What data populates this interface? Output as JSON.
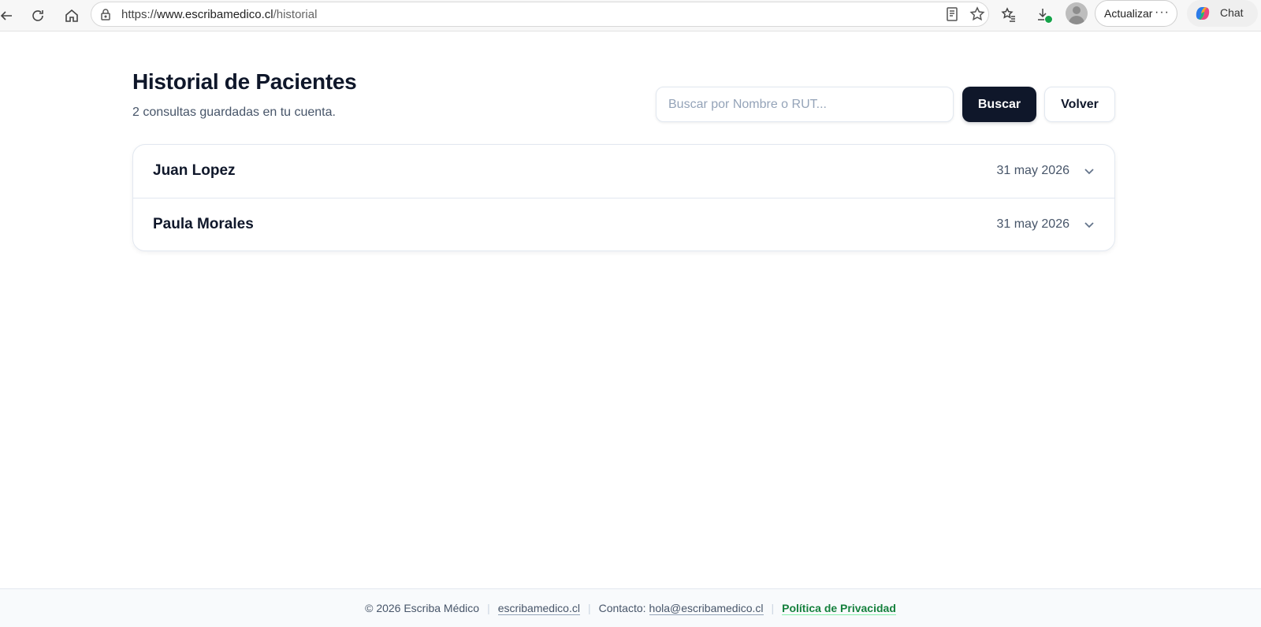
{
  "browser": {
    "url_scheme": "https://",
    "url_host": "www.escribamedico.cl",
    "url_path": "/historial",
    "update_label": "Actualizar",
    "more_label": "···",
    "chat_label": "Chat"
  },
  "header": {
    "title": "Historial de Pacientes",
    "subtitle": "2 consultas guardadas en tu cuenta."
  },
  "search": {
    "placeholder": "Buscar por Nombre o RUT...",
    "value": "",
    "search_label": "Buscar",
    "back_label": "Volver"
  },
  "patients": [
    {
      "name": "Juan Lopez",
      "date": "31 may 2026"
    },
    {
      "name": "Paula Morales",
      "date": "31 may 2026"
    }
  ],
  "footer": {
    "copyright": "© 2026 Escriba Médico",
    "site_link": "escribamedico.cl",
    "contact_label": "Contacto:",
    "contact_email": "hola@escribamedico.cl",
    "privacy_link": "Política de Privacidad",
    "separator": "|"
  },
  "colors": {
    "primary_dark": "#0f172a",
    "muted_text": "#475569",
    "border": "#e2e8f0",
    "privacy_green": "#15803d"
  }
}
